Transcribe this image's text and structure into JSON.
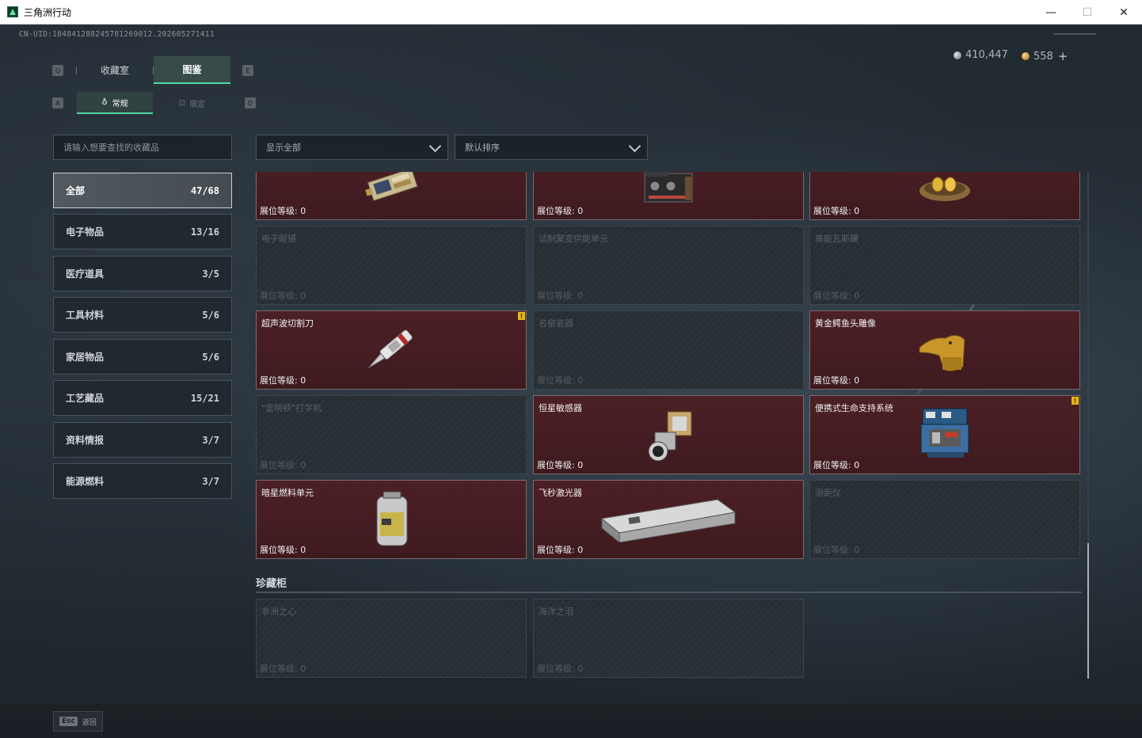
{
  "window": {
    "title": "三角洲行动"
  },
  "header": {
    "uid": "CN·UID:184841288245781269012.202605271411",
    "currency_silver": "410,447",
    "currency_gold": "558",
    "add_label": "+"
  },
  "tabs": {
    "main": [
      {
        "label": "收藏室",
        "active": false
      },
      {
        "label": "图鉴",
        "active": true
      }
    ],
    "key_left": "Q",
    "key_right": "E",
    "sub": [
      {
        "label": "常规",
        "active": true
      },
      {
        "label": "限定",
        "active": false
      }
    ],
    "sub_key_left": "A",
    "sub_key_right": "D"
  },
  "search": {
    "placeholder": "请输入想要查找的收藏品"
  },
  "filters": {
    "show": "显示全部",
    "sort": "默认排序"
  },
  "categories": [
    {
      "label": "全部",
      "count": "47/68",
      "active": true
    },
    {
      "label": "电子物品",
      "count": "13/16"
    },
    {
      "label": "医疗道具",
      "count": "3/5"
    },
    {
      "label": "工具材料",
      "count": "5/6"
    },
    {
      "label": "家居物品",
      "count": "5/6"
    },
    {
      "label": "工艺藏品",
      "count": "15/21"
    },
    {
      "label": "资料情报",
      "count": "3/7"
    },
    {
      "label": "能源燃料",
      "count": "3/7"
    }
  ],
  "level_label": "展位等级: ",
  "items": [
    {
      "name": "",
      "level": "0",
      "owned": true,
      "icon": "circuit-board-icon"
    },
    {
      "name": "",
      "level": "0",
      "owned": true,
      "icon": "radio-device-icon"
    },
    {
      "name": "",
      "level": "0",
      "owned": true,
      "icon": "golden-eggs-icon"
    },
    {
      "name": "电子眼镜",
      "level": "0",
      "owned": false
    },
    {
      "name": "试制聚变供能单元",
      "level": "0",
      "owned": false
    },
    {
      "name": "高能瓦斯罐",
      "level": "0",
      "owned": false
    },
    {
      "name": "超声波切割刀",
      "level": "0",
      "owned": true,
      "badge": "!",
      "icon": "ultrasonic-knife-icon"
    },
    {
      "name": "名窑瓷器",
      "level": "0",
      "owned": false
    },
    {
      "name": "黄金鳄鱼头雕像",
      "level": "0",
      "owned": true,
      "icon": "gold-crocodile-icon"
    },
    {
      "name": "\"雷明顿\"打字机",
      "level": "0",
      "owned": false
    },
    {
      "name": "恒星敏感器",
      "level": "0",
      "owned": true,
      "icon": "star-sensor-icon"
    },
    {
      "name": "便携式生命支持系统",
      "level": "0",
      "owned": true,
      "badge": "!",
      "icon": "life-support-icon"
    },
    {
      "name": "暗星燃料单元",
      "level": "0",
      "owned": true,
      "icon": "fuel-cell-icon"
    },
    {
      "name": "飞秒激光器",
      "level": "0",
      "owned": true,
      "icon": "femtosecond-laser-icon"
    },
    {
      "name": "测距仪",
      "level": "0",
      "owned": false
    }
  ],
  "section_vault": {
    "title": "珍藏柜",
    "items": [
      {
        "name": "非洲之心",
        "level": "0",
        "owned": false
      },
      {
        "name": "海洋之泪",
        "level": "0",
        "owned": false
      }
    ]
  },
  "footer": {
    "esc_key": "Esc",
    "esc_label": "返回"
  }
}
